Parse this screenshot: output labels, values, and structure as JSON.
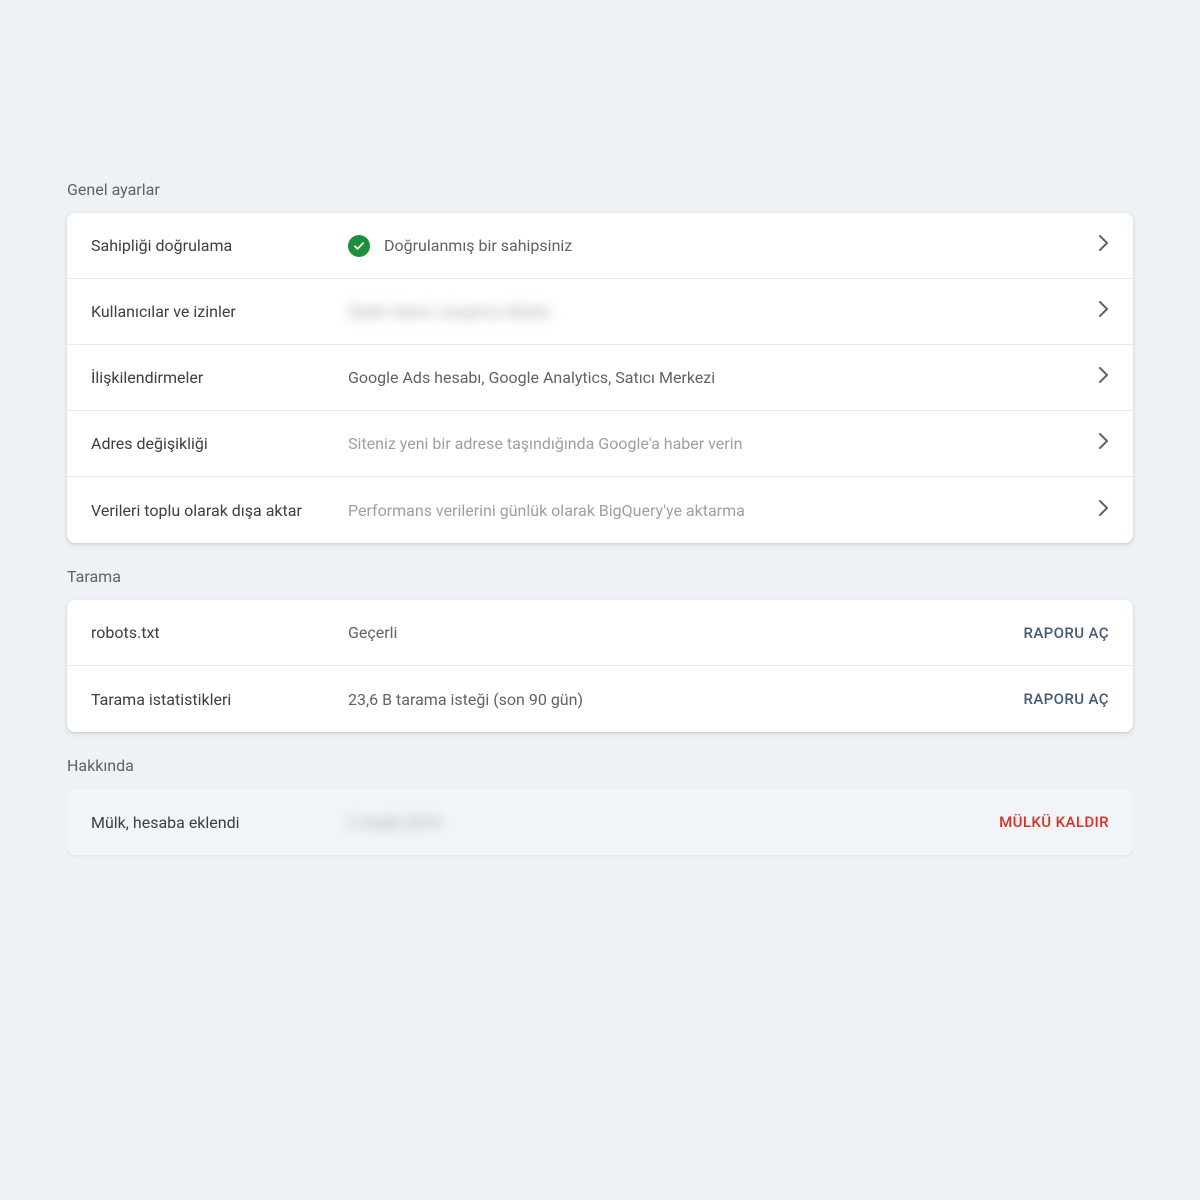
{
  "sections": {
    "general_title": "Genel ayarlar",
    "crawling_title": "Tarama",
    "about_title": "Hakkında"
  },
  "general": {
    "rows": [
      {
        "label": "Sahipliği doğrulama",
        "status_icon": "check-circle-icon",
        "value": "Doğrulanmış bir sahipsiniz"
      },
      {
        "label": "Kullanıcılar ve izinler",
        "value": "Dipkit Ajans Langamy Media",
        "blurred": true
      },
      {
        "label": "İlişkilendirmeler",
        "value": "Google Ads hesabı, Google Analytics, Satıcı Merkezi"
      },
      {
        "label": "Adres değişikliği",
        "value": "Siteniz yeni bir adrese taşındığında Google'a haber verin",
        "muted": true
      },
      {
        "label": "Verileri toplu olarak dışa aktar",
        "value": "Performans verilerini günlük olarak BigQuery'ye aktarma",
        "muted": true
      }
    ]
  },
  "crawling": {
    "rows": [
      {
        "label": "robots.txt",
        "value": "Geçerli",
        "action": "RAPORU AÇ"
      },
      {
        "label": "Tarama istatistikleri",
        "value": "23,6 B tarama isteği (son 90 gün)",
        "action": "RAPORU AÇ"
      }
    ]
  },
  "about": {
    "rows": [
      {
        "label": "Mülk, hesaba eklendi",
        "value": "2 Aralık 2018",
        "blurred": true,
        "action": "MÜLKÜ KALDIR",
        "danger": true
      }
    ]
  }
}
